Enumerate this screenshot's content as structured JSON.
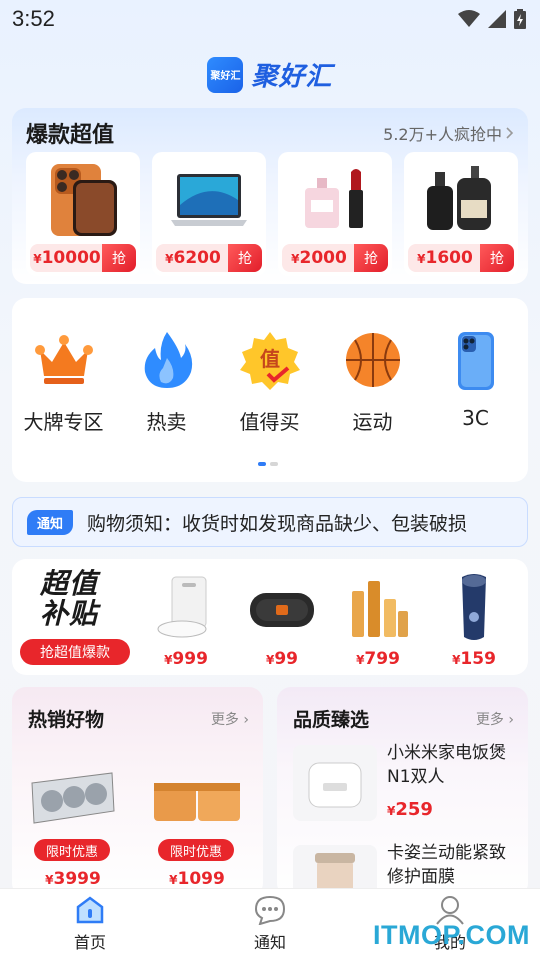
{
  "status": {
    "time": "3:52"
  },
  "app": {
    "logo_badge": "聚好汇",
    "title": "聚好汇"
  },
  "hot": {
    "title": "爆款超值",
    "more": "5.2万+人疯抢中",
    "grab_label": "抢",
    "items": [
      {
        "currency": "¥",
        "price": "10000"
      },
      {
        "currency": "¥",
        "price": "6200"
      },
      {
        "currency": "¥",
        "price": "2000"
      },
      {
        "currency": "¥",
        "price": "1600"
      }
    ]
  },
  "categories": [
    {
      "label": "大牌专区",
      "icon": "crown-icon"
    },
    {
      "label": "热卖",
      "icon": "flame-icon"
    },
    {
      "label": "值得买",
      "icon": "value-badge-icon"
    },
    {
      "label": "运动",
      "icon": "basketball-icon"
    },
    {
      "label": "3C",
      "icon": "phone-icon"
    }
  ],
  "notice": {
    "tag": "通知",
    "text": "购物须知：收货时如发现商品缺少、包装破损"
  },
  "subsidy": {
    "title_line1": "超值",
    "title_line2": "补贴",
    "button": "抢超值爆款",
    "items": [
      {
        "currency": "¥",
        "price": "999"
      },
      {
        "currency": "¥",
        "price": "99"
      },
      {
        "currency": "¥",
        "price": "799"
      },
      {
        "currency": "¥",
        "price": "159"
      }
    ]
  },
  "bestsellers": {
    "title": "热销好物",
    "more": "更多",
    "items": [
      {
        "tag": "限时优惠",
        "currency": "¥",
        "price": "3999"
      },
      {
        "tag": "限时优惠",
        "currency": "¥",
        "price": "1099"
      }
    ]
  },
  "quality": {
    "title": "品质臻选",
    "more": "更多",
    "items": [
      {
        "name": "小米米家电饭煲N1双人",
        "currency": "¥",
        "price": "259"
      },
      {
        "name": "卡姿兰动能紧致修护面膜",
        "currency": "",
        "price": ""
      }
    ]
  },
  "tabs": [
    {
      "label": "首页"
    },
    {
      "label": "通知"
    },
    {
      "label": "我的"
    }
  ],
  "watermark": "ITMOP.COM",
  "colors": {
    "accent": "#2f7cf6",
    "price_red": "#e8262b"
  }
}
